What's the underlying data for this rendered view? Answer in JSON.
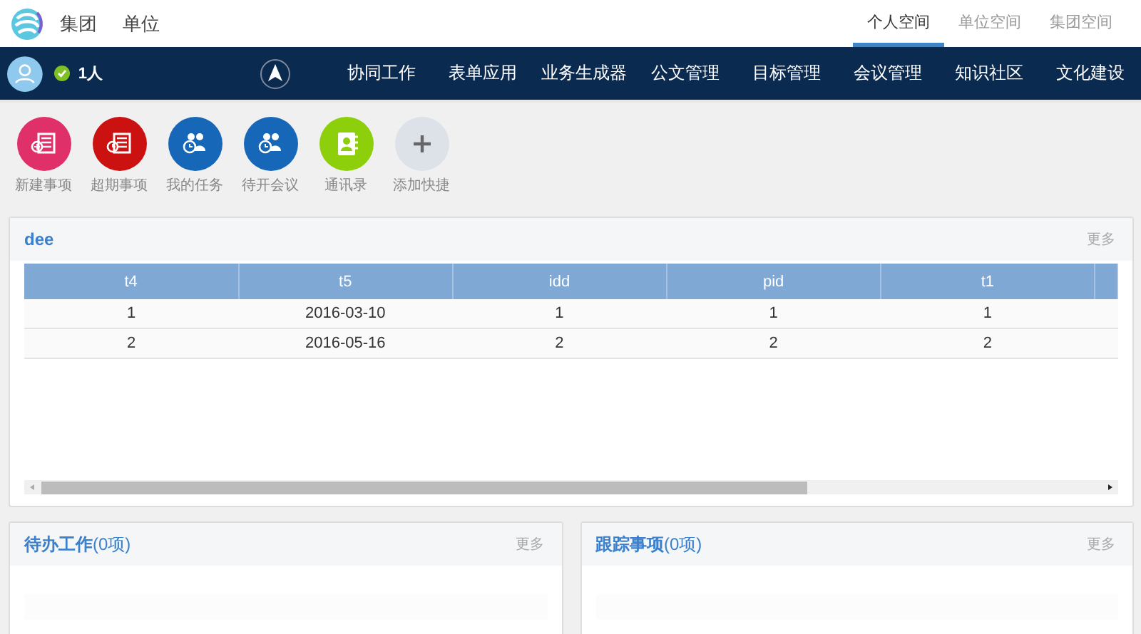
{
  "top_bar": {
    "links": [
      {
        "label": "集团"
      },
      {
        "label": "单位"
      }
    ],
    "space_tabs": [
      {
        "label": "个人空间",
        "selected": true
      },
      {
        "label": "单位空间",
        "selected": false
      },
      {
        "label": "集团空间",
        "selected": false
      }
    ]
  },
  "nav": {
    "online_status": {
      "online": true,
      "count": "1人"
    },
    "menu": [
      "协同工作",
      "表单应用",
      "业务生成器",
      "公文管理",
      "目标管理",
      "会议管理",
      "知识社区",
      "文化建设"
    ]
  },
  "shortcuts": [
    {
      "label": "新建事项",
      "kind": "doc-new",
      "color": "#e0306a"
    },
    {
      "label": "超期事项",
      "kind": "doc-late",
      "color": "#cc1111"
    },
    {
      "label": "我的任务",
      "kind": "people",
      "color": "#1767b8"
    },
    {
      "label": "待开会议",
      "kind": "people",
      "color": "#1767b8"
    },
    {
      "label": "通讯录",
      "kind": "contacts",
      "color": "#8ccf0a"
    },
    {
      "label": "添加快捷",
      "kind": "add",
      "color": "#dde2e8"
    }
  ],
  "table_panel": {
    "title": "dee",
    "more": "更多",
    "table": {
      "columns": [
        "t4",
        "t5",
        "idd",
        "pid",
        "t1"
      ],
      "rows": [
        [
          "1",
          "2016-03-10",
          "1",
          "1",
          "1"
        ],
        [
          "2",
          "2016-05-16",
          "2",
          "2",
          "2"
        ]
      ]
    }
  },
  "bottom_panels": [
    {
      "title": "**待办工作**(0项)",
      "more": "更多"
    },
    {
      "title": "**跟踪事项**(0项)",
      "more": "更多"
    }
  ]
}
